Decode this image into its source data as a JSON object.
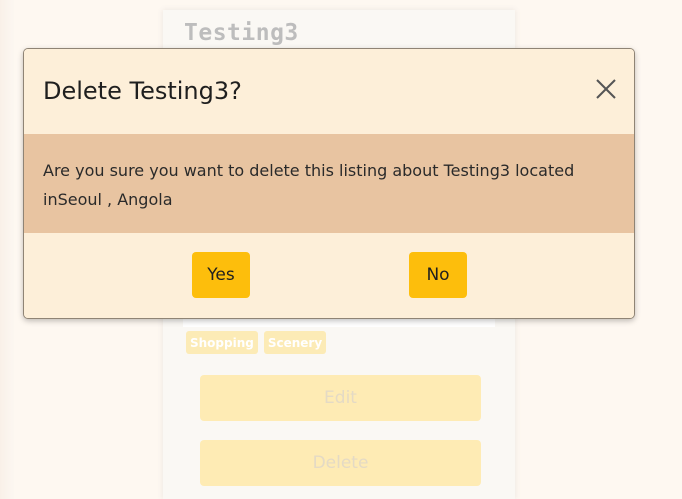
{
  "listing_card": {
    "title": "Testing3",
    "tags": [
      "Shopping",
      "Scenery"
    ],
    "edit_label": "Edit",
    "delete_label": "Delete"
  },
  "modal": {
    "title": "Delete Testing3?",
    "close_icon": "close-icon",
    "body": "Are you sure you want to delete this listing about Testing3 located inSeoul , Angola",
    "yes_label": "Yes",
    "no_label": "No"
  },
  "colors": {
    "modal_header_bg": "#fdefd9",
    "modal_body_bg": "#e8c4a1",
    "primary_button": "#fdbe0c",
    "faded_button": "#fde08c"
  }
}
